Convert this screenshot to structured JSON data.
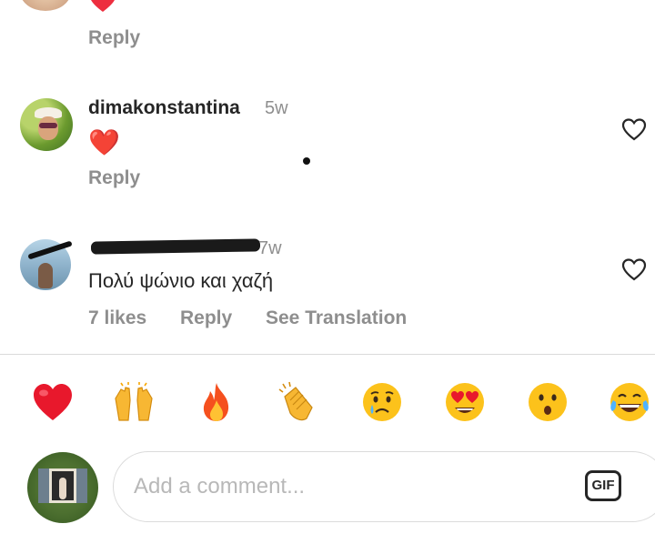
{
  "comments": [
    {
      "reply_label": "Reply"
    },
    {
      "username": "dimakonstantina",
      "time": "5w",
      "text": "❤️",
      "reply_label": "Reply"
    },
    {
      "time": "7w",
      "text": "Πολύ  ψώνιο  και χαζή",
      "likes": "7 likes",
      "reply_label": "Reply",
      "translate_label": "See Translation"
    }
  ],
  "quick_reactions": [
    "heart",
    "raised-hands",
    "fire",
    "clapping-hands",
    "crying-face",
    "heart-eyes",
    "surprised-face",
    "tears-of-joy"
  ],
  "composer": {
    "placeholder": "Add a comment...",
    "gif_label": "GIF"
  },
  "colors": {
    "text": "#262626",
    "secondary": "#8e8e8e",
    "heart_red": "#ed2e3f",
    "border": "#dbdbdb"
  }
}
